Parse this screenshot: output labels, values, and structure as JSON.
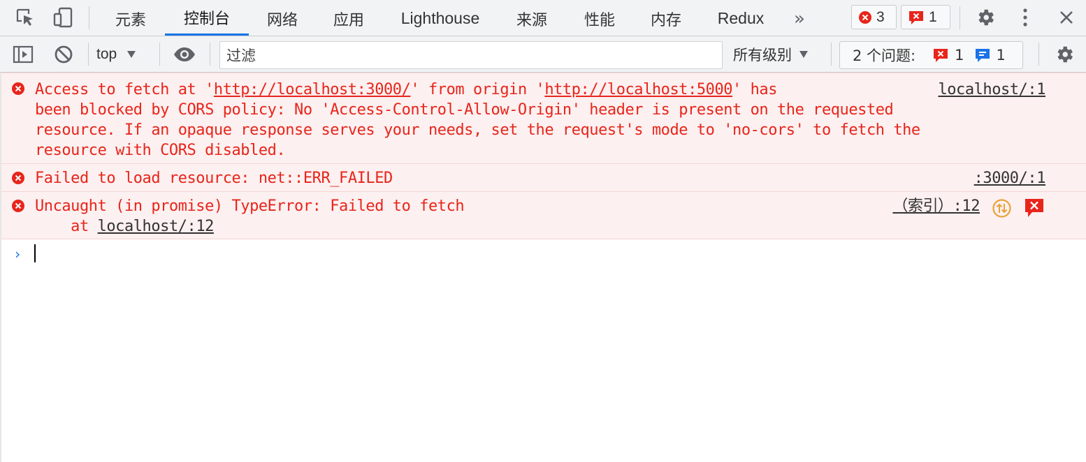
{
  "tabs": [
    {
      "label": "元素",
      "active": false
    },
    {
      "label": "控制台",
      "active": true
    },
    {
      "label": "网络",
      "active": false
    },
    {
      "label": "应用",
      "active": false
    },
    {
      "label": "Lighthouse",
      "active": false
    },
    {
      "label": "来源",
      "active": false
    },
    {
      "label": "性能",
      "active": false
    },
    {
      "label": "内存",
      "active": false
    },
    {
      "label": "Redux",
      "active": false
    }
  ],
  "tabbar": {
    "more_label": "»",
    "error_count": "3",
    "issue_count": "1"
  },
  "toolbar": {
    "context": "top",
    "filter_placeholder": "过滤",
    "levels": "所有级别",
    "issues_label": "2 个问题:",
    "issues_error_count": "1",
    "issues_info_count": "1"
  },
  "messages": {
    "m1": {
      "p1": "Access to fetch at '",
      "url1": "http://localhost:3000/",
      "p2": "' from origin '",
      "url2": "http://localhost:5000",
      "p3": "' has",
      "line2": "been blocked by CORS policy: No 'Access-Control-Allow-Origin' header is present on the requested",
      "line3": "resource. If an opaque response serves your needs, set the request's mode to 'no-cors' to fetch the",
      "line4": "resource with CORS disabled.",
      "source": "localhost/:1"
    },
    "m2": {
      "text": "Failed to load resource: net::ERR_FAILED",
      "source": ":3000/:1"
    },
    "m3": {
      "text": "Uncaught (in promise) TypeError: Failed to fetch",
      "at": "    at ",
      "at_link": "localhost/:12",
      "source": "（索引）:12"
    }
  },
  "colors": {
    "error_red": "#e8251b",
    "accent_blue": "#1a73e8",
    "message_bg": "#fcf0f0"
  }
}
